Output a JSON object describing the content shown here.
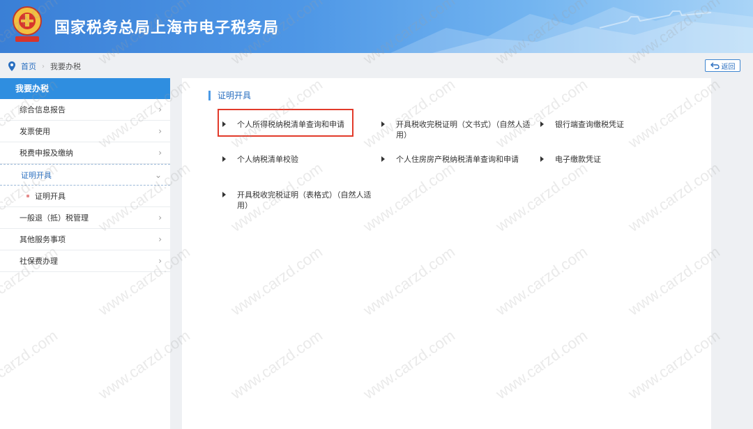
{
  "header": {
    "site_title": "国家税务总局上海市电子税务局",
    "logo_icon": "tax-emblem-icon"
  },
  "breadcrumb": {
    "home": "首页",
    "current": "我要办税",
    "back_label": "返回"
  },
  "sidebar": {
    "heading": "我要办税",
    "items": [
      {
        "label": "综合信息报告",
        "chevron": "›"
      },
      {
        "label": "发票使用",
        "chevron": "›"
      },
      {
        "label": "税费申报及缴纳",
        "chevron": "›"
      },
      {
        "label": "证明开具",
        "chevron": "⌄"
      },
      {
        "label": "证明开具"
      },
      {
        "label": "一般退（抵）税管理",
        "chevron": "›"
      },
      {
        "label": "其他服务事项",
        "chevron": "›"
      },
      {
        "label": "社保费办理",
        "chevron": "›"
      }
    ]
  },
  "content": {
    "section_title": "证明开具",
    "functions": [
      "个人所得税纳税清单查询和申请",
      "开具税收完税证明（文书式）（自然人适用）",
      "银行端查询缴税凭证",
      "个人纳税清单校验",
      "个人住房房产税纳税清单查询和申请",
      "电子缴款凭证",
      "开具税收完税证明（表格式）（自然人适用）"
    ]
  },
  "watermark": "www.carzd.com",
  "colors": {
    "accent": "#2f8ee0",
    "link": "#2a6fc0",
    "highlight": "#e23a2a",
    "background": "#eef0f3"
  }
}
